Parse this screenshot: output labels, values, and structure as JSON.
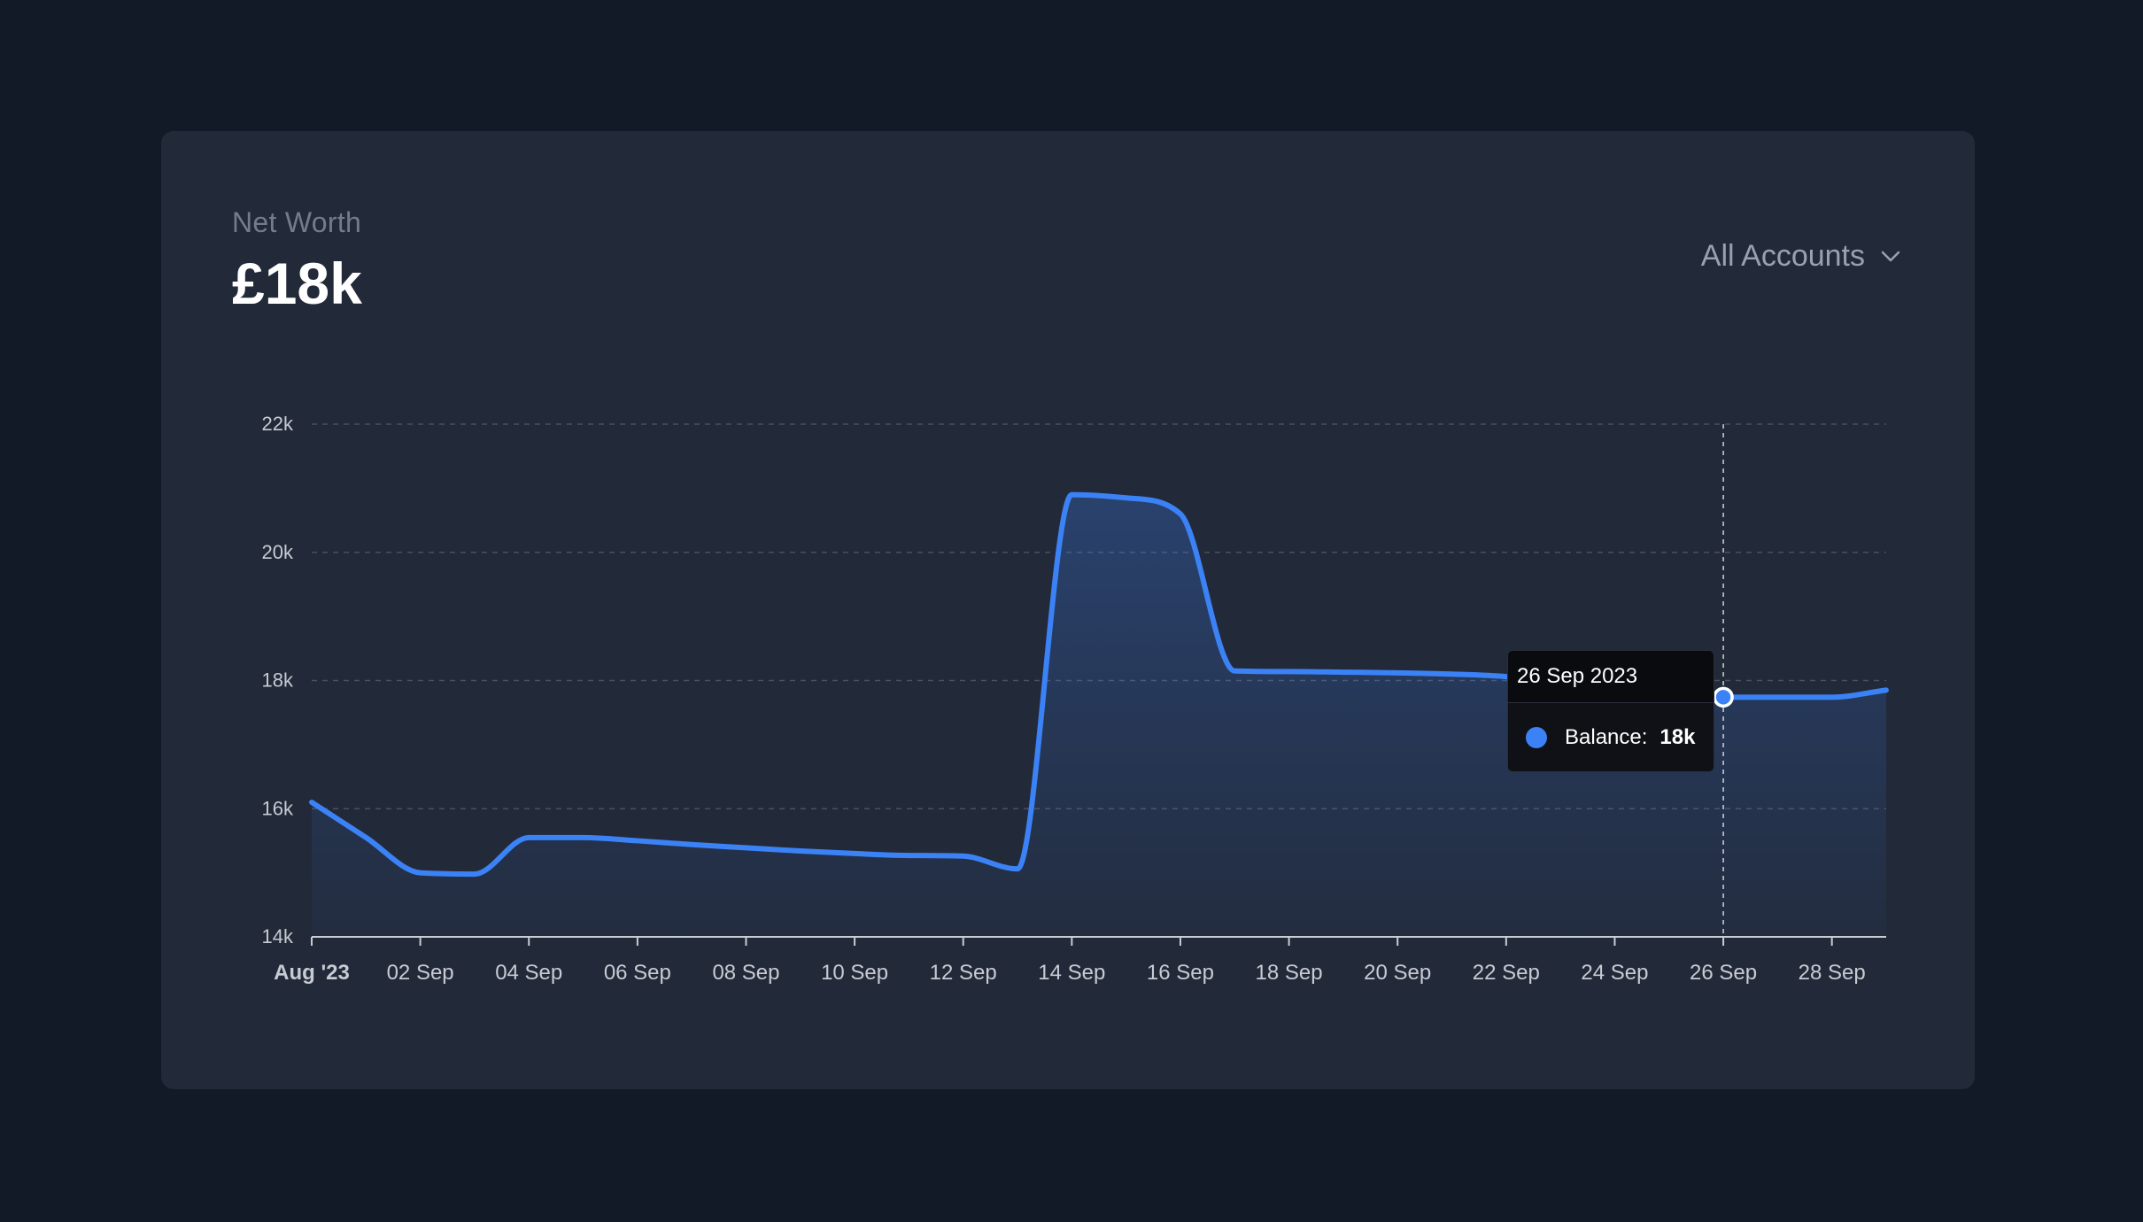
{
  "header": {
    "title": "Net Worth",
    "value": "£18k"
  },
  "account_select": {
    "selected": "All Accounts",
    "icon": "chevron-down-icon"
  },
  "colors": {
    "background": "#131a27",
    "card": "#222938",
    "line": "#3b82f6",
    "grid": "#4a505c",
    "axis_text": "#c7cbd3"
  },
  "tooltip": {
    "date": "26 Sep 2023",
    "series_label": "Balance:",
    "value": "18k"
  },
  "chart_data": {
    "type": "area",
    "title": "",
    "xlabel": "",
    "ylabel": "",
    "grid": true,
    "ylim": [
      14000,
      22000
    ],
    "yticks": [
      {
        "value": 14000,
        "label": "14k"
      },
      {
        "value": 16000,
        "label": "16k"
      },
      {
        "value": 18000,
        "label": "18k"
      },
      {
        "value": 20000,
        "label": "20k"
      },
      {
        "value": 22000,
        "label": "22k"
      }
    ],
    "xlim": [
      "2023-08-31",
      "2023-09-29"
    ],
    "xticks": [
      {
        "x": "2023-08-31",
        "label": "Aug '23",
        "bold": true
      },
      {
        "x": "2023-09-02",
        "label": "02 Sep"
      },
      {
        "x": "2023-09-04",
        "label": "04 Sep"
      },
      {
        "x": "2023-09-06",
        "label": "06 Sep"
      },
      {
        "x": "2023-09-08",
        "label": "08 Sep"
      },
      {
        "x": "2023-09-10",
        "label": "10 Sep"
      },
      {
        "x": "2023-09-12",
        "label": "12 Sep"
      },
      {
        "x": "2023-09-14",
        "label": "14 Sep"
      },
      {
        "x": "2023-09-16",
        "label": "16 Sep"
      },
      {
        "x": "2023-09-18",
        "label": "18 Sep"
      },
      {
        "x": "2023-09-20",
        "label": "20 Sep"
      },
      {
        "x": "2023-09-22",
        "label": "22 Sep"
      },
      {
        "x": "2023-09-24",
        "label": "24 Sep"
      },
      {
        "x": "2023-09-26",
        "label": "26 Sep"
      },
      {
        "x": "2023-09-28",
        "label": "28 Sep"
      }
    ],
    "series": [
      {
        "points": [
          {
            "x": "2023-08-31",
            "y": 16100
          },
          {
            "x": "2023-09-01",
            "y": 15550
          },
          {
            "x": "2023-09-02",
            "y": 15000
          },
          {
            "x": "2023-09-03",
            "y": 14980
          },
          {
            "x": "2023-09-04",
            "y": 15550
          },
          {
            "x": "2023-09-05",
            "y": 15550
          },
          {
            "x": "2023-09-06",
            "y": 15500
          },
          {
            "x": "2023-09-07",
            "y": 15440
          },
          {
            "x": "2023-09-08",
            "y": 15390
          },
          {
            "x": "2023-09-09",
            "y": 15340
          },
          {
            "x": "2023-09-10",
            "y": 15300
          },
          {
            "x": "2023-09-11",
            "y": 15270
          },
          {
            "x": "2023-09-12",
            "y": 15260
          },
          {
            "x": "2023-09-13",
            "y": 15060
          },
          {
            "x": "2023-09-14",
            "y": 20900
          },
          {
            "x": "2023-09-15",
            "y": 20850
          },
          {
            "x": "2023-09-16",
            "y": 20600
          },
          {
            "x": "2023-09-17",
            "y": 18150
          },
          {
            "x": "2023-09-18",
            "y": 18140
          },
          {
            "x": "2023-09-19",
            "y": 18130
          },
          {
            "x": "2023-09-20",
            "y": 18120
          },
          {
            "x": "2023-09-21",
            "y": 18100
          },
          {
            "x": "2023-09-22",
            "y": 18060
          },
          {
            "x": "2023-09-23",
            "y": 17950
          },
          {
            "x": "2023-09-24",
            "y": 17850
          },
          {
            "x": "2023-09-25",
            "y": 17780
          },
          {
            "x": "2023-09-26",
            "y": 17740
          },
          {
            "x": "2023-09-27",
            "y": 17740
          },
          {
            "x": "2023-09-28",
            "y": 17740
          },
          {
            "x": "2023-09-29",
            "y": 17850
          }
        ]
      }
    ],
    "highlight": {
      "x": "2023-09-26",
      "y": 17740
    }
  }
}
